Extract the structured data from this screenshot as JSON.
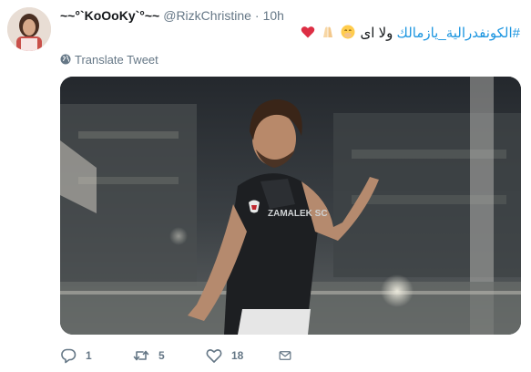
{
  "author": {
    "display_name": "~~°`KoOoKy`°~~",
    "screen_name": "@RizkChristine",
    "separator": "·",
    "time": "10h"
  },
  "tweet": {
    "hashtag": "#الكونفدرالية_يازمالك",
    "text": "ولا اى",
    "emojis": [
      "smiling-face-with-hand-over-mouth",
      "folded-hands",
      "red-heart"
    ]
  },
  "translate": {
    "label": "Translate Tweet",
    "icon": "globe-icon"
  },
  "media": {
    "jersey_text": "ZAMALEK SC"
  },
  "actions": {
    "reply_count": "1",
    "retweet_count": "5",
    "like_count": "18"
  },
  "colors": {
    "link": "#1b95e0",
    "secondary_text": "#657786",
    "primary_text": "#14171a",
    "heart": "#e0245e"
  }
}
